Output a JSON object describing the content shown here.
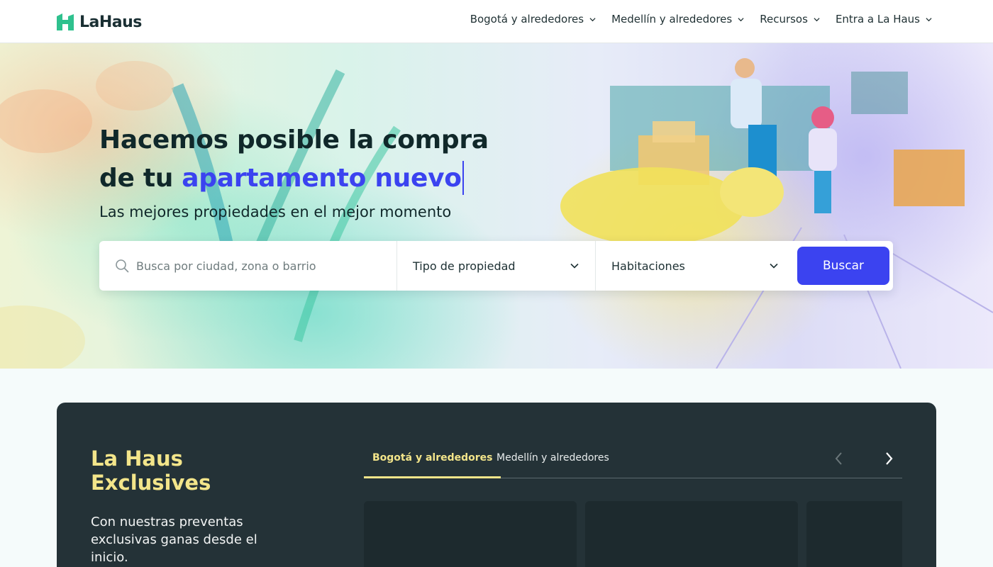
{
  "header": {
    "logo_text": "LaHaus",
    "nav": [
      {
        "label": "Bogotá y alrededores",
        "icon": "chevron-down-icon"
      },
      {
        "label": "Medellín y alrededores",
        "icon": "chevron-down-icon"
      },
      {
        "label": "Recursos",
        "icon": "chevron-down-icon"
      },
      {
        "label": "Entra a La Haus",
        "icon": "chevron-down-icon"
      }
    ]
  },
  "hero": {
    "title_line1": "Hacemos posible la compra",
    "title_line2_prefix": "de tu ",
    "title_line2_accent": "apartamento nuevo",
    "subtitle": "Las mejores propiedades en el mejor momento",
    "accent_color": "#3b43f0"
  },
  "search": {
    "placeholder": "Busca por ciudad, zona o barrio",
    "value": "",
    "property_type": "Tipo de propiedad",
    "rooms": "Habitaciones",
    "button_label": "Buscar"
  },
  "exclusives": {
    "title": "La Haus Exclusives",
    "description": "Con nuestras preventas exclusivas ganas desde el inicio.",
    "tabs": [
      {
        "label": "Bogotá y alrededores",
        "active": true
      },
      {
        "label": "Medellín y alrededores",
        "active": false
      }
    ],
    "prev_icon": "chevron-left-icon",
    "next_icon": "chevron-right-icon",
    "title_color": "#f3e58a",
    "background_color": "#243237"
  }
}
